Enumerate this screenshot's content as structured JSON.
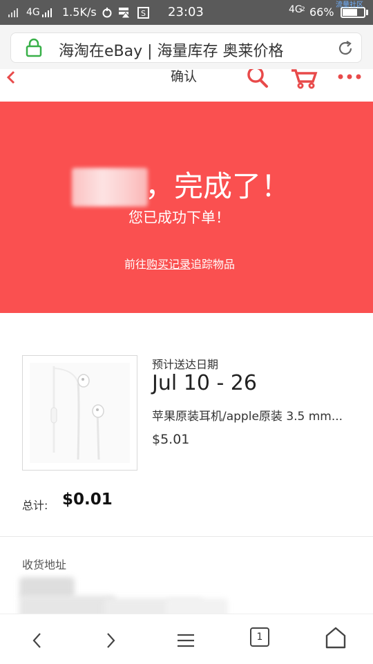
{
  "status_bar": {
    "network": "4G",
    "speed": "1.5K/s",
    "time": "23:03",
    "network_right": "4G",
    "network_right_sub": "2",
    "battery": "66%",
    "battery_level": 0.66,
    "watermark": "流量社区"
  },
  "browser": {
    "address_title": "海淘在eBay | 海量库存 奥莱价格"
  },
  "page": {
    "heading": "确认"
  },
  "banner": {
    "done": "，完成了！",
    "success": "您已成功下单！",
    "track_prefix": "前往",
    "track_link": "购买记录",
    "track_suffix": "追踪物品"
  },
  "order": {
    "delivery_label": "预计送达日期",
    "delivery_range": "Jul 10 - 26",
    "product_title": "苹果原装耳机/apple原装 3.5 mm...",
    "product_price": "$5.01",
    "total_label": "总计:",
    "total_value": "$0.01"
  },
  "shipping": {
    "label": "收货地址"
  },
  "colors": {
    "accent": "#e84a4a",
    "banner": "#fa5050"
  },
  "bottom_nav": {
    "tabs_count": "1"
  }
}
